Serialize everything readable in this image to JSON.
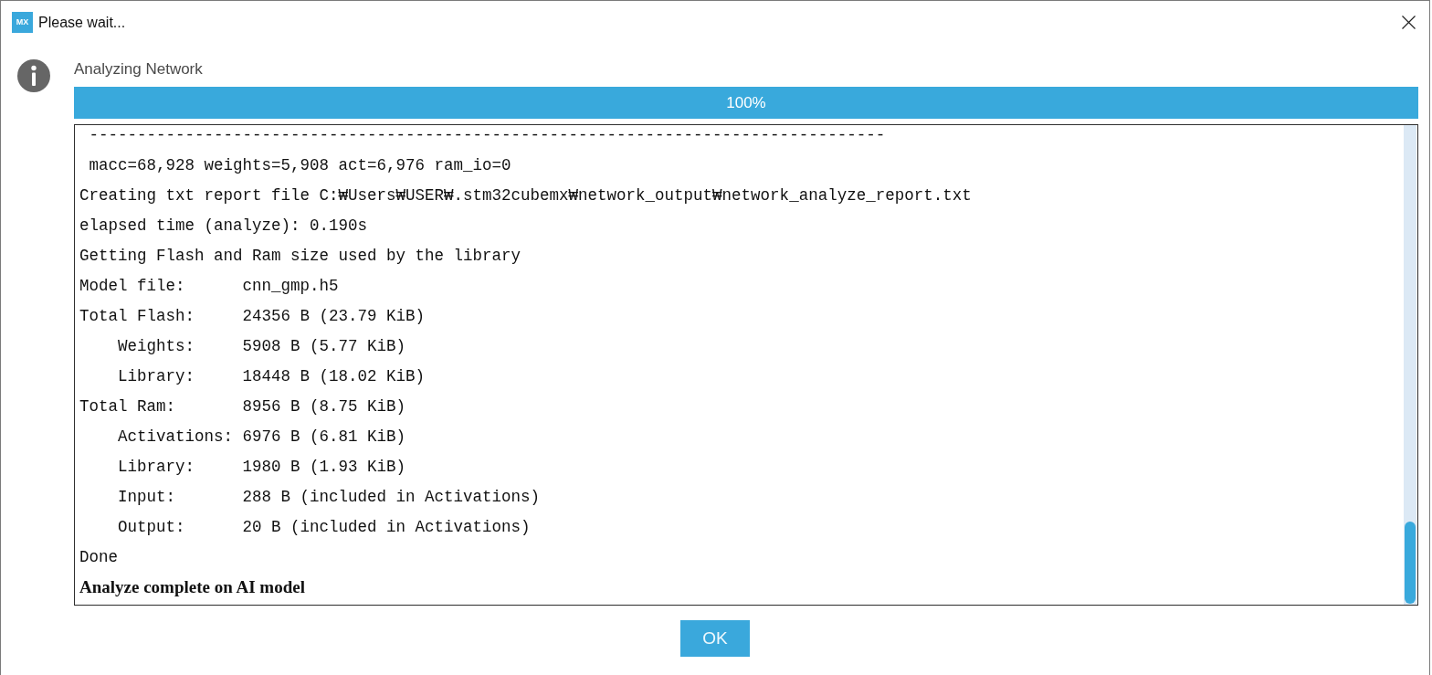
{
  "window": {
    "logo_text": "MX",
    "title": "Please wait..."
  },
  "message": {
    "heading": "Analyzing Network"
  },
  "progress": {
    "level": 1,
    "reading": "100%"
  },
  "log": {
    "lines": [
      {
        "kind": "mono",
        "text": " -----------------------------------------------------------------------------------"
      },
      {
        "kind": "mono",
        "text": " macc=68,928 weights=5,908 act=6,976 ram_io=0"
      },
      {
        "kind": "mono",
        "text": "Creating txt report file C:₩Users₩USER₩.stm32cubemx₩network_output₩network_analyze_report.txt"
      },
      {
        "kind": "mono",
        "text": "elapsed time (analyze): 0.190s"
      },
      {
        "kind": "mono",
        "text": "Getting Flash and Ram size used by the library"
      },
      {
        "kind": "mono",
        "text": "Model file:      cnn_gmp.h5"
      },
      {
        "kind": "mono",
        "text": "Total Flash:     24356 B (23.79 KiB)"
      },
      {
        "kind": "mono",
        "text": "    Weights:     5908 B (5.77 KiB)"
      },
      {
        "kind": "mono",
        "text": "    Library:     18448 B (18.02 KiB)"
      },
      {
        "kind": "mono",
        "text": "Total Ram:       8956 B (8.75 KiB)"
      },
      {
        "kind": "mono",
        "text": "    Activations: 6976 B (6.81 KiB)"
      },
      {
        "kind": "mono",
        "text": "    Library:     1980 B (1.93 KiB)"
      },
      {
        "kind": "mono",
        "text": "    Input:       288 B (included in Activations)"
      },
      {
        "kind": "mono",
        "text": "    Output:      20 B (included in Activations)"
      },
      {
        "kind": "mono",
        "text": "Done"
      },
      {
        "kind": "bold",
        "text": "Analyze complete on AI model"
      }
    ]
  },
  "buttons": [
    {
      "label": "OK"
    }
  ]
}
